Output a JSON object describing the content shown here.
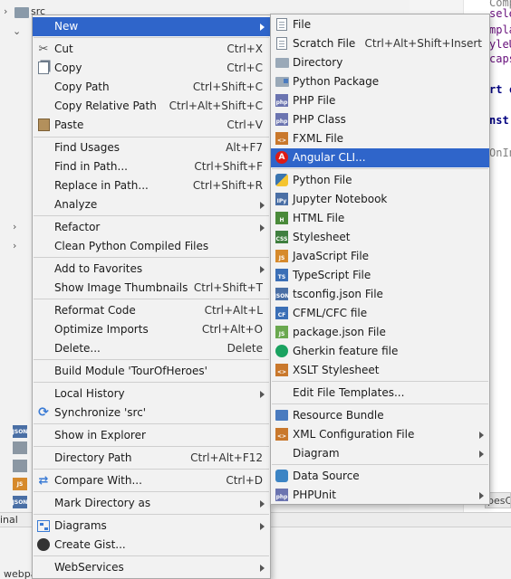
{
  "background": {
    "tree_root_label": "src",
    "terminal_tab": "inal",
    "bottom_text": "webpa",
    "editor_tab_fragment": "pesC",
    "code_lines": [
      "Compo",
      "selec",
      "mplat",
      "yleU",
      "capsu",
      "rt c",
      "nst",
      "OnIn"
    ]
  },
  "main_menu": {
    "items": [
      {
        "label": "New",
        "shortcut": "",
        "icon": "none",
        "arrow": true,
        "highlighted": true
      },
      {
        "label": "Cut",
        "shortcut": "Ctrl+X",
        "icon": "scissors-icon"
      },
      {
        "label": "Copy",
        "shortcut": "Ctrl+C",
        "icon": "copy-icon"
      },
      {
        "label": "Copy Path",
        "shortcut": "Ctrl+Shift+C",
        "icon": "none"
      },
      {
        "label": "Copy Relative Path",
        "shortcut": "Ctrl+Alt+Shift+C",
        "icon": "none"
      },
      {
        "label": "Paste",
        "shortcut": "Ctrl+V",
        "icon": "paste-icon"
      },
      {
        "label": "Find Usages",
        "shortcut": "Alt+F7",
        "icon": "none"
      },
      {
        "label": "Find in Path...",
        "shortcut": "Ctrl+Shift+F",
        "icon": "none"
      },
      {
        "label": "Replace in Path...",
        "shortcut": "Ctrl+Shift+R",
        "icon": "none"
      },
      {
        "label": "Analyze",
        "shortcut": "",
        "icon": "none",
        "arrow": true
      },
      {
        "label": "Refactor",
        "shortcut": "",
        "icon": "none",
        "arrow": true
      },
      {
        "label": "Clean Python Compiled Files",
        "shortcut": "",
        "icon": "none"
      },
      {
        "label": "Add to Favorites",
        "shortcut": "",
        "icon": "none",
        "arrow": true
      },
      {
        "label": "Show Image Thumbnails",
        "shortcut": "Ctrl+Shift+T",
        "icon": "none"
      },
      {
        "label": "Reformat Code",
        "shortcut": "Ctrl+Alt+L",
        "icon": "none"
      },
      {
        "label": "Optimize Imports",
        "shortcut": "Ctrl+Alt+O",
        "icon": "none"
      },
      {
        "label": "Delete...",
        "shortcut": "Delete",
        "icon": "none"
      },
      {
        "label": "Build Module 'TourOfHeroes'",
        "shortcut": "",
        "icon": "none"
      },
      {
        "label": "Local History",
        "shortcut": "",
        "icon": "none",
        "arrow": true
      },
      {
        "label": "Synchronize 'src'",
        "shortcut": "",
        "icon": "sync-icon"
      },
      {
        "label": "Show in Explorer",
        "shortcut": "",
        "icon": "none"
      },
      {
        "label": "Directory Path",
        "shortcut": "Ctrl+Alt+F12",
        "icon": "none"
      },
      {
        "label": "Compare With...",
        "shortcut": "Ctrl+D",
        "icon": "compare-icon"
      },
      {
        "label": "Mark Directory as",
        "shortcut": "",
        "icon": "none",
        "arrow": true
      },
      {
        "label": "Diagrams",
        "shortcut": "",
        "icon": "diagram-icon",
        "arrow": true
      },
      {
        "label": "Create Gist...",
        "shortcut": "",
        "icon": "github-icon"
      },
      {
        "label": "WebServices",
        "shortcut": "",
        "icon": "none",
        "arrow": true
      }
    ]
  },
  "new_submenu": {
    "items": [
      {
        "label": "File",
        "shortcut": "",
        "icon": "file-icon"
      },
      {
        "label": "Scratch File",
        "shortcut": "Ctrl+Alt+Shift+Insert",
        "icon": "scratch-file-icon"
      },
      {
        "label": "Directory",
        "shortcut": "",
        "icon": "folder-icon"
      },
      {
        "label": "Python Package",
        "shortcut": "",
        "icon": "package-icon"
      },
      {
        "label": "PHP File",
        "shortcut": "",
        "icon": "php-file-icon",
        "badge": "php",
        "badge_color": "#6b74b0"
      },
      {
        "label": "PHP Class",
        "shortcut": "",
        "icon": "php-class-icon",
        "badge": "php",
        "badge_color": "#6b74b0"
      },
      {
        "label": "FXML File",
        "shortcut": "",
        "icon": "fxml-icon",
        "badge": "<>",
        "badge_color": "#c9782c"
      },
      {
        "label": "Angular CLI...",
        "shortcut": "",
        "icon": "angular-icon",
        "highlighted": true
      },
      {
        "label": "Python File",
        "shortcut": "",
        "icon": "python-icon"
      },
      {
        "label": "Jupyter Notebook",
        "shortcut": "",
        "icon": "jupyter-icon",
        "badge": "IPy",
        "badge_color": "#4a6fa5"
      },
      {
        "label": "HTML File",
        "shortcut": "",
        "icon": "html-icon",
        "badge": "H",
        "badge_color": "#4a8a3a"
      },
      {
        "label": "Stylesheet",
        "shortcut": "",
        "icon": "css-icon",
        "badge": "CSS",
        "badge_color": "#3f7f3f"
      },
      {
        "label": "JavaScript File",
        "shortcut": "",
        "icon": "javascript-icon",
        "badge": "JS",
        "badge_color": "#d68a2c"
      },
      {
        "label": "TypeScript File",
        "shortcut": "",
        "icon": "typescript-icon",
        "badge": "TS",
        "badge_color": "#3b6fb6"
      },
      {
        "label": "tsconfig.json File",
        "shortcut": "",
        "icon": "json-icon",
        "badge": "JSON",
        "badge_color": "#4a6fa5"
      },
      {
        "label": "CFML/CFC file",
        "shortcut": "",
        "icon": "cfml-icon",
        "badge": "CF",
        "badge_color": "#3b6fb6"
      },
      {
        "label": "package.json File",
        "shortcut": "",
        "icon": "nodejs-icon",
        "badge": "JS",
        "badge_color": "#6aa84f"
      },
      {
        "label": "Gherkin feature file",
        "shortcut": "",
        "icon": "gherkin-icon"
      },
      {
        "label": "XSLT Stylesheet",
        "shortcut": "",
        "icon": "xslt-icon",
        "badge": "<>",
        "badge_color": "#c9782c"
      },
      {
        "label": "Edit File Templates...",
        "shortcut": "",
        "icon": "none"
      },
      {
        "label": "Resource Bundle",
        "shortcut": "",
        "icon": "resource-bundle-icon"
      },
      {
        "label": "XML Configuration File",
        "shortcut": "",
        "icon": "xml-config-icon",
        "badge": "<>",
        "badge_color": "#c9782c",
        "arrow": true
      },
      {
        "label": "Diagram",
        "shortcut": "",
        "icon": "none",
        "arrow": true
      },
      {
        "label": "Data Source",
        "shortcut": "",
        "icon": "database-icon"
      },
      {
        "label": "PHPUnit",
        "shortcut": "",
        "icon": "phpunit-icon",
        "badge": "php",
        "badge_color": "#6b74b0",
        "arrow": true
      }
    ]
  },
  "colors": {
    "highlight": "#2f65ca",
    "menu_bg": "#f2f2f2",
    "border": "#a9a9a9"
  }
}
